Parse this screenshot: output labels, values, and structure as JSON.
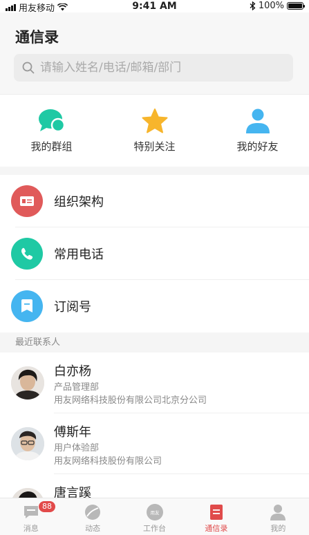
{
  "status_bar": {
    "carrier": "用友移动",
    "time": "9:41 AM",
    "battery": "100%"
  },
  "header": {
    "title": "通信录",
    "search_placeholder": "请输入姓名/电话/邮箱/部门"
  },
  "quick_links": [
    {
      "label": "我的群组",
      "icon": "group-chat-icon"
    },
    {
      "label": "特别关注",
      "icon": "star-icon"
    },
    {
      "label": "我的好友",
      "icon": "person-icon"
    }
  ],
  "menu": [
    {
      "label": "组织架构",
      "icon": "id-card-icon",
      "color": "#e05a5a"
    },
    {
      "label": "常用电话",
      "icon": "phone-icon",
      "color": "#1fc9a4"
    },
    {
      "label": "订阅号",
      "icon": "bookmark-icon",
      "color": "#45b5f0"
    }
  ],
  "recent_section_label": "最近联系人",
  "contacts": [
    {
      "name": "白亦杨",
      "dept": "产品管理部",
      "company": "用友网络科技股份有限公司北京分公司"
    },
    {
      "name": "傅斯年",
      "dept": "用户体验部",
      "company": "用友网络科技股份有限公司"
    },
    {
      "name": "唐言蹊",
      "dept": "",
      "company": ""
    }
  ],
  "tabbar": {
    "tabs": [
      {
        "label": "消息",
        "icon": "message-icon",
        "badge": "88"
      },
      {
        "label": "动态",
        "icon": "dynamic-icon"
      },
      {
        "label": "工作台",
        "icon": "workbench-icon",
        "icon_text": "用友"
      },
      {
        "label": "通信录",
        "icon": "contacts-icon"
      },
      {
        "label": "我的",
        "icon": "profile-icon"
      }
    ],
    "active_index": 3
  },
  "colors": {
    "accent": "#e04b4b",
    "teal": "#1fc9a4",
    "blue": "#45b5f0",
    "star": "#f7b52c"
  }
}
